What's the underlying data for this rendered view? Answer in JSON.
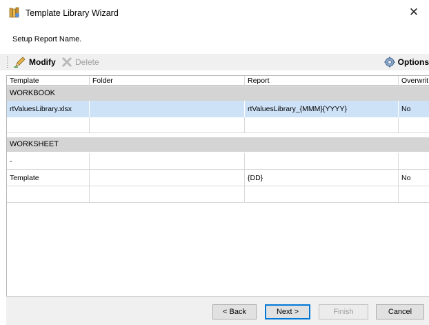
{
  "window": {
    "title": "Template Library Wizard",
    "close_glyph": "✕"
  },
  "subtitle": "Setup Report Name.",
  "toolbar": {
    "modify_label": "Modify",
    "delete_label": "Delete",
    "options_label": "Options"
  },
  "grid": {
    "columns": [
      "Template",
      "Folder",
      "Report",
      "Overwrit"
    ],
    "groups": [
      {
        "label": "WORKBOOK"
      },
      {
        "label": "WORKSHEET"
      }
    ],
    "rows": [
      {
        "template": "rtValuesLibrary.xlsx",
        "folder": "",
        "report": "rtValuesLibrary_{MMM}{YYYY}",
        "overwrite": "No",
        "selected": true
      },
      {
        "template": "",
        "folder": "",
        "report": "",
        "overwrite": ""
      },
      {
        "template": "-",
        "folder": "",
        "report": "",
        "overwrite": ""
      },
      {
        "template": "Template",
        "folder": "",
        "report": "{DD}",
        "overwrite": "No"
      },
      {
        "template": "",
        "folder": "",
        "report": "",
        "overwrite": ""
      }
    ]
  },
  "buttons": {
    "back": "< Back",
    "next": "Next >",
    "finish": "Finish",
    "cancel": "Cancel"
  },
  "colors": {
    "selection": "#cde1f7",
    "group_band": "#d4d4d4",
    "accent": "#0078d7"
  }
}
